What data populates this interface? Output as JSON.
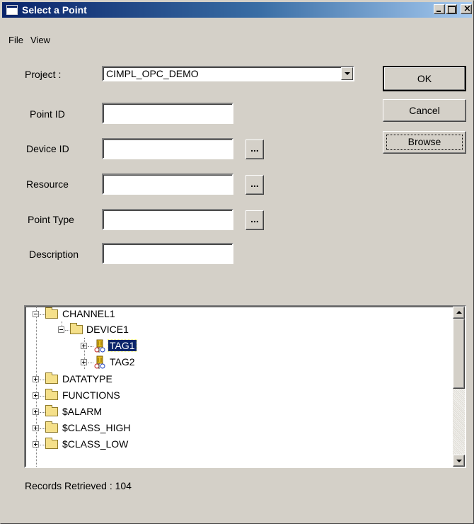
{
  "window": {
    "title": "Select a Point",
    "minimize_icon": "minimize-icon",
    "maximize_icon": "maximize-icon",
    "close_icon": "close-icon",
    "close_glyph": "×"
  },
  "menu": {
    "file": "File",
    "view": "View"
  },
  "form": {
    "project_label": "Project :",
    "project_value": "CIMPL_OPC_DEMO",
    "point_id_label": "Point ID",
    "point_id_value": "",
    "device_id_label": "Device ID",
    "device_id_value": "",
    "resource_label": "Resource",
    "resource_value": "",
    "point_type_label": "Point Type",
    "point_type_value": "",
    "description_label": "Description",
    "description_value": "",
    "browse_dots": "..."
  },
  "buttons": {
    "ok": "OK",
    "cancel": "Cancel",
    "browse": "Browse"
  },
  "tree": {
    "items": [
      {
        "label": "CHANNEL1",
        "icon": "folder-icon",
        "expanded": true
      },
      {
        "label": "DEVICE1",
        "icon": "folder-icon",
        "expanded": true
      },
      {
        "label": "TAG1",
        "icon": "tag-icon",
        "expanded": false,
        "selected": true
      },
      {
        "label": "TAG2",
        "icon": "tag-icon",
        "expanded": false
      },
      {
        "label": "DATATYPE",
        "icon": "folder-icon",
        "expanded": false
      },
      {
        "label": "FUNCTIONS",
        "icon": "folder-icon",
        "expanded": false
      },
      {
        "label": "$ALARM",
        "icon": "folder-icon",
        "expanded": false
      },
      {
        "label": "$CLASS_HIGH",
        "icon": "folder-icon",
        "expanded": false
      },
      {
        "label": "$CLASS_LOW",
        "icon": "folder-icon",
        "expanded": false
      }
    ]
  },
  "status": {
    "records": "Records Retrieved : 104"
  },
  "colors": {
    "title_gradient_start": "#0a246a",
    "title_gradient_end": "#a6caf0",
    "dialog_face": "#d4d0c8",
    "selection": "#0a246a"
  }
}
